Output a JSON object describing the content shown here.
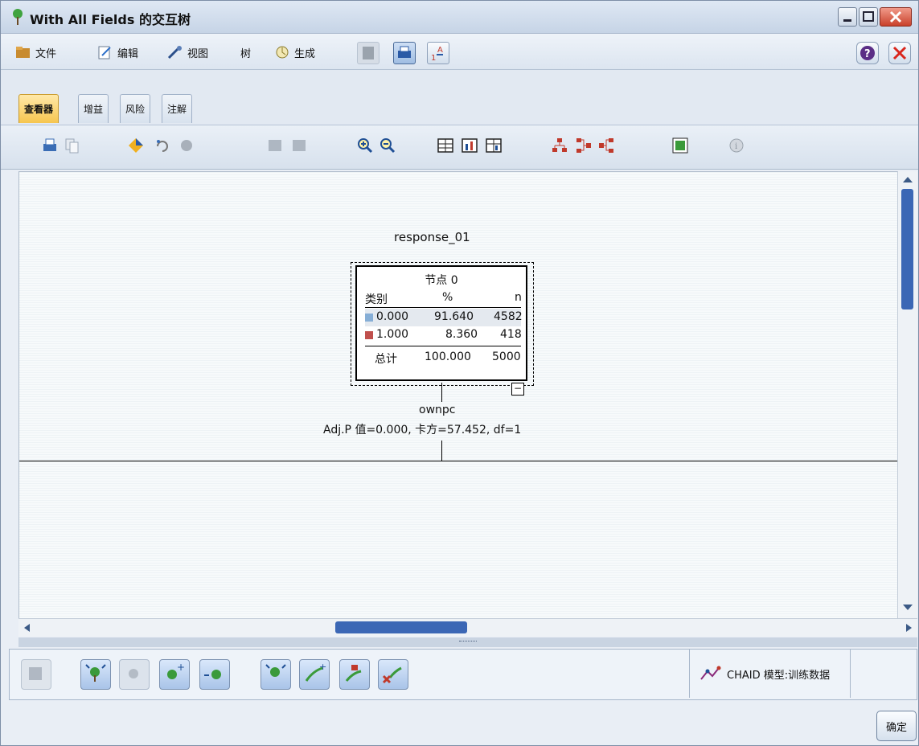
{
  "window": {
    "title": "With All Fields 的交互树"
  },
  "menu": {
    "items": [
      {
        "label": "文件",
        "icon": "folder-icon"
      },
      {
        "label": "编辑",
        "icon": "edit-icon"
      },
      {
        "label": "视图",
        "icon": "view-icon"
      },
      {
        "label": "树",
        "icon": ""
      },
      {
        "label": "生成",
        "icon": "generate-icon"
      }
    ]
  },
  "tabs": [
    {
      "label": "查看器",
      "active": true
    },
    {
      "label": "增益",
      "active": false
    },
    {
      "label": "风险",
      "active": false
    },
    {
      "label": "注解",
      "active": false
    }
  ],
  "tree": {
    "target_field": "response_01",
    "node": {
      "title": "节点 0",
      "headers": [
        "类别",
        "%",
        "n"
      ],
      "rows": [
        {
          "category": "0.000",
          "pct": "91.640",
          "n": "4582",
          "color": "#86aed6"
        },
        {
          "category": "1.000",
          "pct": "8.360",
          "n": "418",
          "color": "#c0504d"
        }
      ],
      "total": {
        "label": "总计",
        "pct": "100.000",
        "n": "5000"
      },
      "collapse_symbol": "−"
    },
    "split_field": "ownpc",
    "split_stats": "Adj.P 值=0.000, 卡方=57.452, df=1"
  },
  "status": {
    "model_label": "CHAID 模型:训练数据"
  },
  "buttons": {
    "ok": "确定"
  }
}
